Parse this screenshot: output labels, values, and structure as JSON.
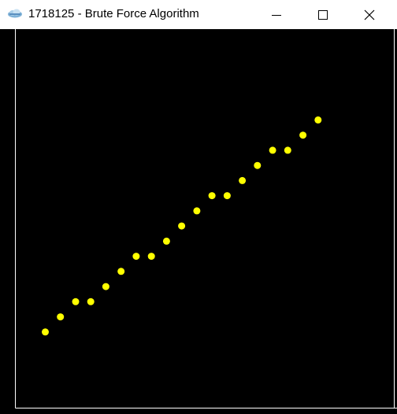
{
  "window": {
    "title": "1718125 - Brute Force Algorithm",
    "icon": "app-cloud-icon",
    "controls": {
      "minimize": "minimize-icon",
      "maximize": "maximize-icon",
      "close": "close-icon"
    }
  },
  "colors": {
    "titlebar_bg": "#ffffff",
    "canvas_bg": "#000000",
    "frame": "#ffffff",
    "point_fill": "#ffff00"
  },
  "chart_data": {
    "type": "scatter",
    "points": [
      {
        "x": 1,
        "y": 1
      },
      {
        "x": 2,
        "y": 2
      },
      {
        "x": 3,
        "y": 3
      },
      {
        "x": 4,
        "y": 3
      },
      {
        "x": 5,
        "y": 4
      },
      {
        "x": 6,
        "y": 5
      },
      {
        "x": 7,
        "y": 6
      },
      {
        "x": 8,
        "y": 6
      },
      {
        "x": 9,
        "y": 7
      },
      {
        "x": 10,
        "y": 8
      },
      {
        "x": 11,
        "y": 9
      },
      {
        "x": 12,
        "y": 10
      },
      {
        "x": 13,
        "y": 10
      },
      {
        "x": 14,
        "y": 11
      },
      {
        "x": 15,
        "y": 12
      },
      {
        "x": 16,
        "y": 13
      },
      {
        "x": 17,
        "y": 13
      },
      {
        "x": 18,
        "y": 14
      },
      {
        "x": 19,
        "y": 15
      }
    ],
    "xlim": [
      -1,
      24
    ],
    "ylim": [
      -4,
      21
    ],
    "grid": false,
    "legend": "none"
  }
}
